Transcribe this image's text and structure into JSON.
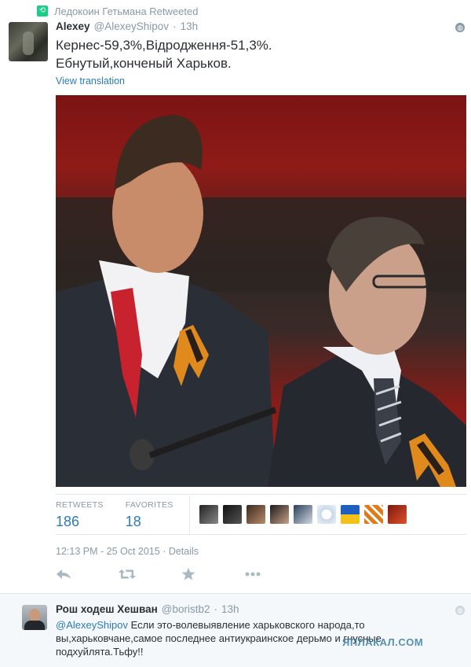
{
  "retweet_bar": {
    "text": "Ледокоин Гетьмана Retweeted",
    "icon": "retweet-icon"
  },
  "tweet": {
    "name": "Alexey",
    "handle": "@AlexeyShipov",
    "dot": "·",
    "time": "13h",
    "text_line1": "Кернес-59,3%,Відродження-51,3%.",
    "text_line2": "Ебнутый,конченый Харьков.",
    "translate": "View translation"
  },
  "stats": {
    "retweets_label": "RETWEETS",
    "retweets_value": "186",
    "favorites_label": "FAVORITES",
    "favorites_value": "18"
  },
  "favoriters_count": 10,
  "datetime": {
    "stamp": "12:13 PM - 25 Oct 2015",
    "sep": " · ",
    "details": "Details"
  },
  "actions": [
    "reply-icon",
    "retweet-icon",
    "favorite-icon",
    "more-icon"
  ],
  "reply": {
    "name": "Рош ходеш Хешван",
    "handle": "@boristb2",
    "dot": "·",
    "time": "13h",
    "mention": "@AlexeyShipov",
    "text_rest": " Если это-волевыявление харьковского народа,то вы,харьковчане,самое последнее антиукраинское дерьмо и гнусные подхуйлята.Тьфу!!"
  },
  "watermark": "ЯПЛАКАЛ.COM",
  "colors": {
    "link": "#2b7bb9",
    "muted": "#8899a6",
    "text": "#292f33",
    "retweet_green": "#19cf86"
  }
}
